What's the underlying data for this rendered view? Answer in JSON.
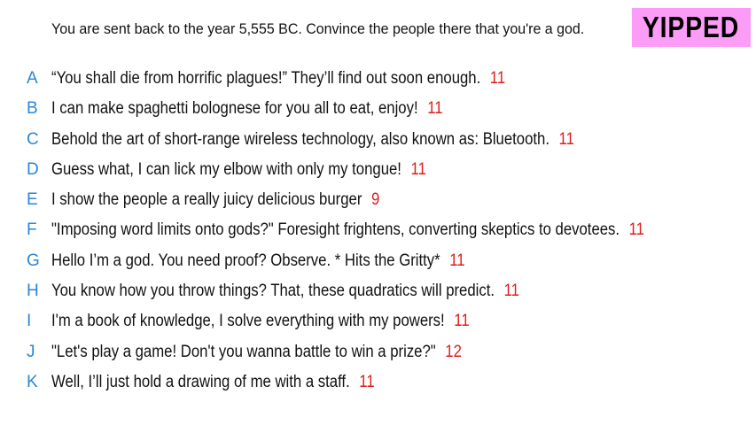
{
  "prompt": "You are sent back to the year 5,555 BC. Convince the people there that you're a god.",
  "brand": {
    "label": "YIPPED",
    "color": "#fb9df6"
  },
  "colors": {
    "letter": "#2a86d6",
    "score": "#e01b1b",
    "text": "#111111"
  },
  "answers": [
    {
      "letter": "A",
      "text": "“You shall die from horrific plagues!” They’ll find out soon enough.",
      "score": "11"
    },
    {
      "letter": "B",
      "text": "I can make spaghetti bolognese for you all to eat, enjoy!",
      "score": "11"
    },
    {
      "letter": "C",
      "text": "Behold the art of short-range wireless technology, also known as: Bluetooth.",
      "score": "11"
    },
    {
      "letter": "D",
      "text": "Guess what, I can lick my elbow with only my tongue!",
      "score": "11"
    },
    {
      "letter": "E",
      "text": "I show the people a really juicy delicious burger",
      "score": "9"
    },
    {
      "letter": "F",
      "text": "\"Imposing word limits onto gods?\" Foresight frightens, converting skeptics to devotees.",
      "score": "11"
    },
    {
      "letter": "G",
      "text": "Hello I’m a god. You need proof? Observe. * Hits the Gritty*",
      "score": "11"
    },
    {
      "letter": "H",
      "text": "You know how you throw things? That, these quadratics will predict.",
      "score": "11"
    },
    {
      "letter": "I",
      "text": "I'm a book of knowledge, I solve everything with my powers!",
      "score": "11"
    },
    {
      "letter": "J",
      "text": "\"Let's play a game! Don't you wanna battle to win a prize?\"",
      "score": "12"
    },
    {
      "letter": "K",
      "text": "Well, I’ll just hold a drawing of me with a staff.",
      "score": "11"
    }
  ]
}
